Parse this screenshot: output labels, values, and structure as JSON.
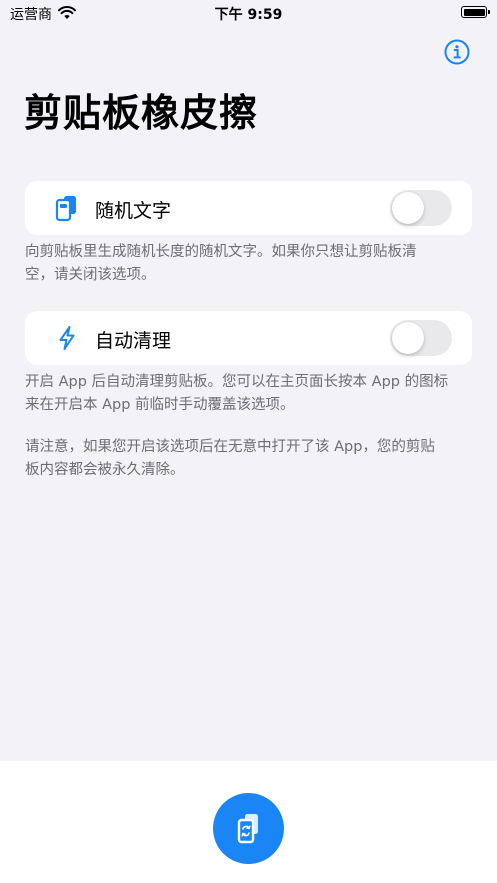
{
  "status_bar": {
    "carrier": "运营商",
    "time": "下午 9:59"
  },
  "header": {
    "title": "剪贴板橡皮擦"
  },
  "settings": [
    {
      "label": "随机文字",
      "enabled": false,
      "icon": "clipboard-phone-icon",
      "description": [
        "向剪贴板里生成随机长度的随机文字。如果你只想让剪贴板清",
        "空，请关闭该选项。"
      ]
    },
    {
      "label": "自动清理",
      "enabled": false,
      "icon": "lightning-icon",
      "description": [
        "开启 App 后自动清理剪贴板。您可以在主页面长按本 App 的图标",
        "来在开启本 App 前临时手动覆盖该选项。"
      ]
    }
  ],
  "warning": [
    "请注意，如果您开启该选项后在无意中打开了该 App，您的剪贴",
    "板内容都会被永久清除。"
  ],
  "colors": {
    "accent": "#1a86f5",
    "background": "#f2f2f7",
    "toggle_off": "#e9e9eb",
    "secondary_text": "#6d6d72"
  }
}
